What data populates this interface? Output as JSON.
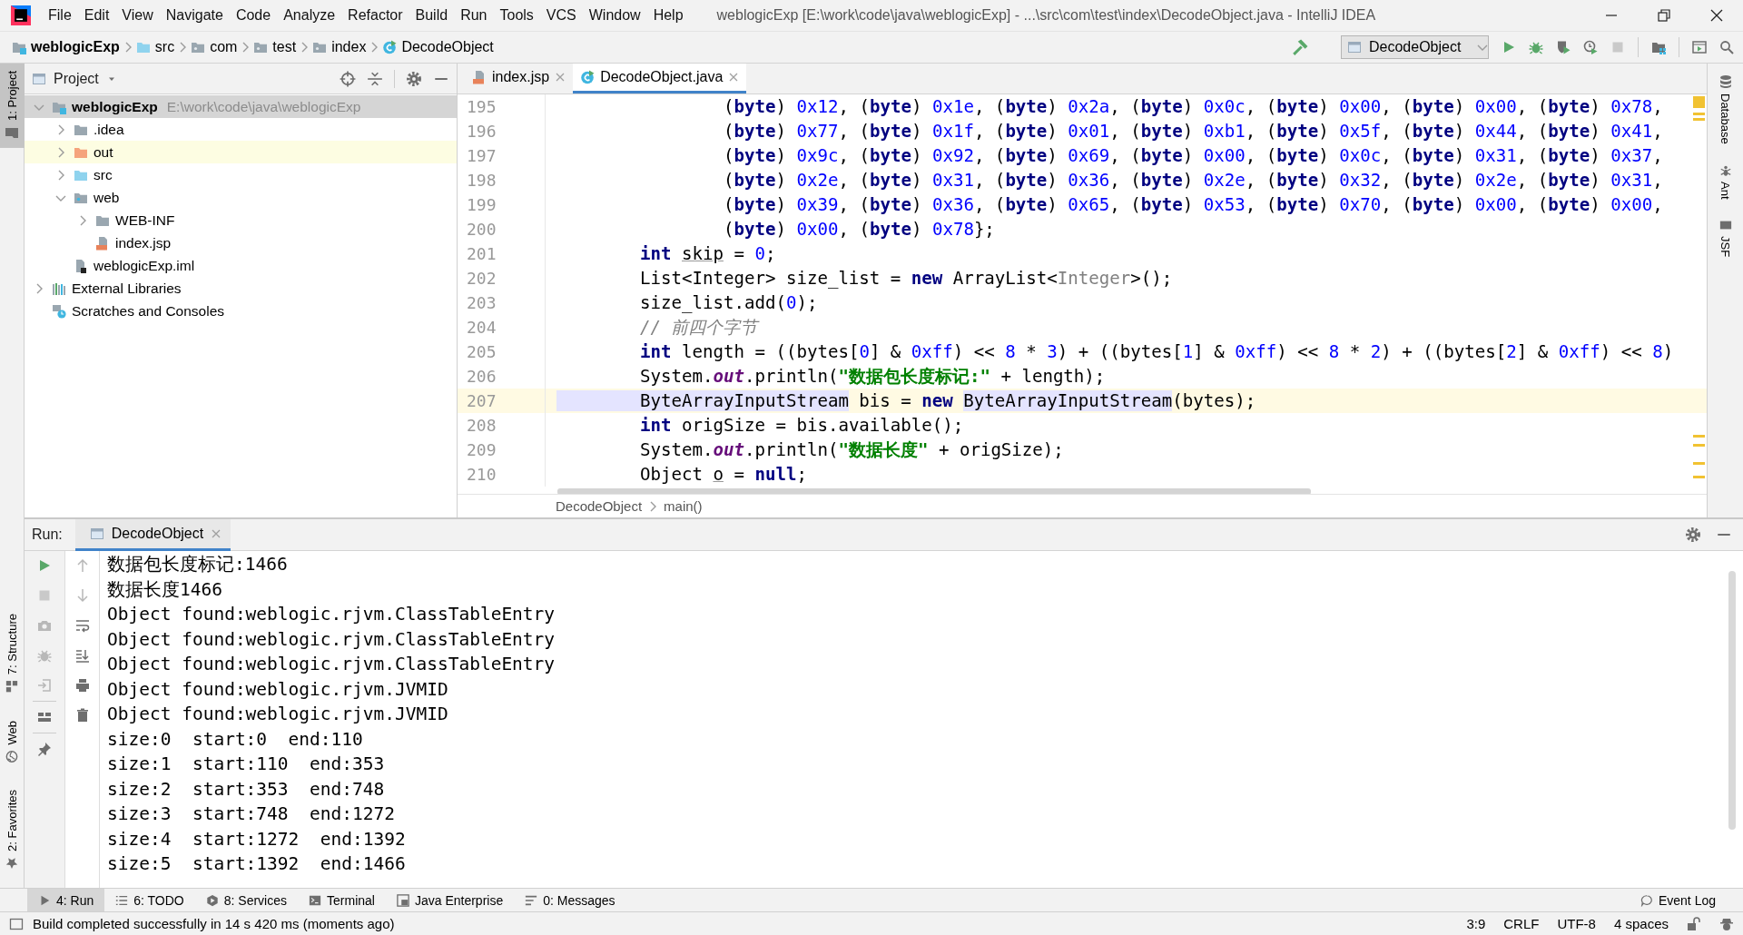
{
  "window": {
    "title": "weblogicExp [E:\\work\\code\\java\\weblogicExp] - ...\\src\\com\\test\\index\\DecodeObject.java - IntelliJ IDEA"
  },
  "menu": [
    "File",
    "Edit",
    "View",
    "Navigate",
    "Code",
    "Analyze",
    "Refactor",
    "Build",
    "Run",
    "Tools",
    "VCS",
    "Window",
    "Help"
  ],
  "breadcrumbs": [
    {
      "label": "weblogicExp",
      "kind": "module"
    },
    {
      "label": "src",
      "kind": "source"
    },
    {
      "label": "com",
      "kind": "package"
    },
    {
      "label": "test",
      "kind": "package"
    },
    {
      "label": "index",
      "kind": "package"
    },
    {
      "label": "DecodeObject",
      "kind": "class"
    }
  ],
  "run_configuration": "DecodeObject",
  "left_strip": [
    {
      "label": "1: Project",
      "kind": "project",
      "selected": true
    },
    {
      "label": "7: Structure",
      "kind": "structure",
      "selected": false
    },
    {
      "label": "Web",
      "kind": "web",
      "selected": false
    },
    {
      "label": "2: Favorites",
      "kind": "favorites",
      "selected": false
    }
  ],
  "project": {
    "title": "Project",
    "tree": [
      {
        "label": "weblogicExp",
        "path": "E:\\work\\code\\java\\weblogicExp",
        "kind": "module",
        "selected": true,
        "highlighted": false,
        "expanded": true,
        "children": [
          {
            "label": ".idea",
            "kind": "folder",
            "selected": false,
            "highlighted": false,
            "expanded": false
          },
          {
            "label": "out",
            "kind": "excluded",
            "selected": false,
            "highlighted": true,
            "expanded": false
          },
          {
            "label": "src",
            "kind": "source",
            "selected": false,
            "highlighted": false,
            "expanded": false
          },
          {
            "label": "web",
            "kind": "web",
            "selected": false,
            "highlighted": false,
            "expanded": true,
            "children": [
              {
                "label": "WEB-INF",
                "kind": "folder",
                "selected": false,
                "highlighted": false,
                "expanded": false
              },
              {
                "label": "index.jsp",
                "kind": "jsp",
                "selected": false,
                "highlighted": false
              }
            ]
          },
          {
            "label": "weblogicExp.iml",
            "kind": "iml",
            "selected": false,
            "highlighted": false
          }
        ]
      },
      {
        "label": "External Libraries",
        "kind": "libraries",
        "selected": false,
        "highlighted": false,
        "expanded": false
      },
      {
        "label": "Scratches and Consoles",
        "kind": "scratches",
        "selected": false,
        "highlighted": false
      }
    ]
  },
  "editor": {
    "tabs": [
      {
        "label": "index.jsp",
        "kind": "jsp",
        "selected": false
      },
      {
        "label": "DecodeObject.java",
        "kind": "class",
        "selected": true
      }
    ],
    "lines": [
      {
        "number": "195",
        "current": false,
        "tokens": [
          {
            "kind": "plain",
            "text": "                ("
          },
          {
            "kind": "keyword",
            "text": "byte"
          },
          {
            "kind": "plain",
            "text": ") "
          },
          {
            "kind": "number",
            "text": "0x12"
          },
          {
            "kind": "plain",
            "text": ", ("
          },
          {
            "kind": "keyword",
            "text": "byte"
          },
          {
            "kind": "plain",
            "text": ") "
          },
          {
            "kind": "number",
            "text": "0x1e"
          },
          {
            "kind": "plain",
            "text": ", ("
          },
          {
            "kind": "keyword",
            "text": "byte"
          },
          {
            "kind": "plain",
            "text": ") "
          },
          {
            "kind": "number",
            "text": "0x2a"
          },
          {
            "kind": "plain",
            "text": ", ("
          },
          {
            "kind": "keyword",
            "text": "byte"
          },
          {
            "kind": "plain",
            "text": ") "
          },
          {
            "kind": "number",
            "text": "0x0c"
          },
          {
            "kind": "plain",
            "text": ", ("
          },
          {
            "kind": "keyword",
            "text": "byte"
          },
          {
            "kind": "plain",
            "text": ") "
          },
          {
            "kind": "number",
            "text": "0x00"
          },
          {
            "kind": "plain",
            "text": ", ("
          },
          {
            "kind": "keyword",
            "text": "byte"
          },
          {
            "kind": "plain",
            "text": ") "
          },
          {
            "kind": "number",
            "text": "0x00"
          },
          {
            "kind": "plain",
            "text": ", ("
          },
          {
            "kind": "keyword",
            "text": "byte"
          },
          {
            "kind": "plain",
            "text": ") "
          },
          {
            "kind": "number",
            "text": "0x78"
          },
          {
            "kind": "plain",
            "text": ","
          }
        ]
      },
      {
        "number": "196",
        "current": false,
        "tokens": [
          {
            "kind": "plain",
            "text": "                ("
          },
          {
            "kind": "keyword",
            "text": "byte"
          },
          {
            "kind": "plain",
            "text": ") "
          },
          {
            "kind": "number",
            "text": "0x77"
          },
          {
            "kind": "plain",
            "text": ", ("
          },
          {
            "kind": "keyword",
            "text": "byte"
          },
          {
            "kind": "plain",
            "text": ") "
          },
          {
            "kind": "number",
            "text": "0x1f"
          },
          {
            "kind": "plain",
            "text": ", ("
          },
          {
            "kind": "keyword",
            "text": "byte"
          },
          {
            "kind": "plain",
            "text": ") "
          },
          {
            "kind": "number",
            "text": "0x01"
          },
          {
            "kind": "plain",
            "text": ", ("
          },
          {
            "kind": "keyword",
            "text": "byte"
          },
          {
            "kind": "plain",
            "text": ") "
          },
          {
            "kind": "number",
            "text": "0xb1"
          },
          {
            "kind": "plain",
            "text": ", ("
          },
          {
            "kind": "keyword",
            "text": "byte"
          },
          {
            "kind": "plain",
            "text": ") "
          },
          {
            "kind": "number",
            "text": "0x5f"
          },
          {
            "kind": "plain",
            "text": ", ("
          },
          {
            "kind": "keyword",
            "text": "byte"
          },
          {
            "kind": "plain",
            "text": ") "
          },
          {
            "kind": "number",
            "text": "0x44"
          },
          {
            "kind": "plain",
            "text": ", ("
          },
          {
            "kind": "keyword",
            "text": "byte"
          },
          {
            "kind": "plain",
            "text": ") "
          },
          {
            "kind": "number",
            "text": "0x41"
          },
          {
            "kind": "plain",
            "text": ","
          }
        ]
      },
      {
        "number": "197",
        "current": false,
        "tokens": [
          {
            "kind": "plain",
            "text": "                ("
          },
          {
            "kind": "keyword",
            "text": "byte"
          },
          {
            "kind": "plain",
            "text": ") "
          },
          {
            "kind": "number",
            "text": "0x9c"
          },
          {
            "kind": "plain",
            "text": ", ("
          },
          {
            "kind": "keyword",
            "text": "byte"
          },
          {
            "kind": "plain",
            "text": ") "
          },
          {
            "kind": "number",
            "text": "0x92"
          },
          {
            "kind": "plain",
            "text": ", ("
          },
          {
            "kind": "keyword",
            "text": "byte"
          },
          {
            "kind": "plain",
            "text": ") "
          },
          {
            "kind": "number",
            "text": "0x69"
          },
          {
            "kind": "plain",
            "text": ", ("
          },
          {
            "kind": "keyword",
            "text": "byte"
          },
          {
            "kind": "plain",
            "text": ") "
          },
          {
            "kind": "number",
            "text": "0x00"
          },
          {
            "kind": "plain",
            "text": ", ("
          },
          {
            "kind": "keyword",
            "text": "byte"
          },
          {
            "kind": "plain",
            "text": ") "
          },
          {
            "kind": "number",
            "text": "0x0c"
          },
          {
            "kind": "plain",
            "text": ", ("
          },
          {
            "kind": "keyword",
            "text": "byte"
          },
          {
            "kind": "plain",
            "text": ") "
          },
          {
            "kind": "number",
            "text": "0x31"
          },
          {
            "kind": "plain",
            "text": ", ("
          },
          {
            "kind": "keyword",
            "text": "byte"
          },
          {
            "kind": "plain",
            "text": ") "
          },
          {
            "kind": "number",
            "text": "0x37"
          },
          {
            "kind": "plain",
            "text": ","
          }
        ]
      },
      {
        "number": "198",
        "current": false,
        "tokens": [
          {
            "kind": "plain",
            "text": "                ("
          },
          {
            "kind": "keyword",
            "text": "byte"
          },
          {
            "kind": "plain",
            "text": ") "
          },
          {
            "kind": "number",
            "text": "0x2e"
          },
          {
            "kind": "plain",
            "text": ", ("
          },
          {
            "kind": "keyword",
            "text": "byte"
          },
          {
            "kind": "plain",
            "text": ") "
          },
          {
            "kind": "number",
            "text": "0x31"
          },
          {
            "kind": "plain",
            "text": ", ("
          },
          {
            "kind": "keyword",
            "text": "byte"
          },
          {
            "kind": "plain",
            "text": ") "
          },
          {
            "kind": "number",
            "text": "0x36"
          },
          {
            "kind": "plain",
            "text": ", ("
          },
          {
            "kind": "keyword",
            "text": "byte"
          },
          {
            "kind": "plain",
            "text": ") "
          },
          {
            "kind": "number",
            "text": "0x2e"
          },
          {
            "kind": "plain",
            "text": ", ("
          },
          {
            "kind": "keyword",
            "text": "byte"
          },
          {
            "kind": "plain",
            "text": ") "
          },
          {
            "kind": "number",
            "text": "0x32"
          },
          {
            "kind": "plain",
            "text": ", ("
          },
          {
            "kind": "keyword",
            "text": "byte"
          },
          {
            "kind": "plain",
            "text": ") "
          },
          {
            "kind": "number",
            "text": "0x2e"
          },
          {
            "kind": "plain",
            "text": ", ("
          },
          {
            "kind": "keyword",
            "text": "byte"
          },
          {
            "kind": "plain",
            "text": ") "
          },
          {
            "kind": "number",
            "text": "0x31"
          },
          {
            "kind": "plain",
            "text": ","
          }
        ]
      },
      {
        "number": "199",
        "current": false,
        "tokens": [
          {
            "kind": "plain",
            "text": "                ("
          },
          {
            "kind": "keyword",
            "text": "byte"
          },
          {
            "kind": "plain",
            "text": ") "
          },
          {
            "kind": "number",
            "text": "0x39"
          },
          {
            "kind": "plain",
            "text": ", ("
          },
          {
            "kind": "keyword",
            "text": "byte"
          },
          {
            "kind": "plain",
            "text": ") "
          },
          {
            "kind": "number",
            "text": "0x36"
          },
          {
            "kind": "plain",
            "text": ", ("
          },
          {
            "kind": "keyword",
            "text": "byte"
          },
          {
            "kind": "plain",
            "text": ") "
          },
          {
            "kind": "number",
            "text": "0x65"
          },
          {
            "kind": "plain",
            "text": ", ("
          },
          {
            "kind": "keyword",
            "text": "byte"
          },
          {
            "kind": "plain",
            "text": ") "
          },
          {
            "kind": "number",
            "text": "0x53"
          },
          {
            "kind": "plain",
            "text": ", ("
          },
          {
            "kind": "keyword",
            "text": "byte"
          },
          {
            "kind": "plain",
            "text": ") "
          },
          {
            "kind": "number",
            "text": "0x70"
          },
          {
            "kind": "plain",
            "text": ", ("
          },
          {
            "kind": "keyword",
            "text": "byte"
          },
          {
            "kind": "plain",
            "text": ") "
          },
          {
            "kind": "number",
            "text": "0x00"
          },
          {
            "kind": "plain",
            "text": ", ("
          },
          {
            "kind": "keyword",
            "text": "byte"
          },
          {
            "kind": "plain",
            "text": ") "
          },
          {
            "kind": "number",
            "text": "0x00"
          },
          {
            "kind": "plain",
            "text": ","
          }
        ]
      },
      {
        "number": "200",
        "current": false,
        "tokens": [
          {
            "kind": "plain",
            "text": "                ("
          },
          {
            "kind": "keyword",
            "text": "byte"
          },
          {
            "kind": "plain",
            "text": ") "
          },
          {
            "kind": "number",
            "text": "0x00"
          },
          {
            "kind": "plain",
            "text": ", ("
          },
          {
            "kind": "keyword",
            "text": "byte"
          },
          {
            "kind": "plain",
            "text": ") "
          },
          {
            "kind": "number",
            "text": "0x78"
          },
          {
            "kind": "plain",
            "text": "};"
          }
        ]
      },
      {
        "number": "201",
        "current": false,
        "tokens": [
          {
            "kind": "keyword",
            "text": "        int "
          },
          {
            "kind": "unused",
            "text": "skip"
          },
          {
            "kind": "plain",
            "text": " = "
          },
          {
            "kind": "number",
            "text": "0"
          },
          {
            "kind": "plain",
            "text": ";"
          }
        ]
      },
      {
        "number": "202",
        "current": false,
        "tokens": [
          {
            "kind": "plain",
            "text": "        List<Integer> size_list = "
          },
          {
            "kind": "keyword",
            "text": "new"
          },
          {
            "kind": "plain",
            "text": " ArrayList<"
          },
          {
            "kind": "inferred",
            "text": "Integer"
          },
          {
            "kind": "plain",
            "text": ">();"
          }
        ]
      },
      {
        "number": "203",
        "current": false,
        "tokens": [
          {
            "kind": "plain",
            "text": "        size_list.add("
          },
          {
            "kind": "number",
            "text": "0"
          },
          {
            "kind": "plain",
            "text": ");"
          }
        ]
      },
      {
        "number": "204",
        "current": false,
        "tokens": [
          {
            "kind": "comment",
            "text": "        // 前四个字节"
          }
        ]
      },
      {
        "number": "205",
        "current": false,
        "tokens": [
          {
            "kind": "keyword",
            "text": "        int"
          },
          {
            "kind": "plain",
            "text": " length = ((bytes["
          },
          {
            "kind": "number",
            "text": "0"
          },
          {
            "kind": "plain",
            "text": "] & "
          },
          {
            "kind": "number",
            "text": "0xff"
          },
          {
            "kind": "plain",
            "text": ") << "
          },
          {
            "kind": "number",
            "text": "8"
          },
          {
            "kind": "plain",
            "text": " * "
          },
          {
            "kind": "number",
            "text": "3"
          },
          {
            "kind": "plain",
            "text": ") + ((bytes["
          },
          {
            "kind": "number",
            "text": "1"
          },
          {
            "kind": "plain",
            "text": "] & "
          },
          {
            "kind": "number",
            "text": "0xff"
          },
          {
            "kind": "plain",
            "text": ") << "
          },
          {
            "kind": "number",
            "text": "8"
          },
          {
            "kind": "plain",
            "text": " * "
          },
          {
            "kind": "number",
            "text": "2"
          },
          {
            "kind": "plain",
            "text": ") + ((bytes["
          },
          {
            "kind": "number",
            "text": "2"
          },
          {
            "kind": "plain",
            "text": "] & "
          },
          {
            "kind": "number",
            "text": "0xff"
          },
          {
            "kind": "plain",
            "text": ") << "
          },
          {
            "kind": "number",
            "text": "8"
          },
          {
            "kind": "plain",
            "text": ")"
          }
        ]
      },
      {
        "number": "206",
        "current": false,
        "tokens": [
          {
            "kind": "plain",
            "text": "        System."
          },
          {
            "kind": "static",
            "text": "out"
          },
          {
            "kind": "plain",
            "text": ".println("
          },
          {
            "kind": "string",
            "text": "\"数据包长度标记:\""
          },
          {
            "kind": "plain",
            "text": " + length);"
          }
        ]
      },
      {
        "number": "207",
        "current": true,
        "tokens": [
          {
            "kind": "usage",
            "text": "        ByteArrayInputStream"
          },
          {
            "kind": "plain",
            "text": " bis = "
          },
          {
            "kind": "keyword",
            "text": "new "
          },
          {
            "kind": "usage",
            "text": "ByteArrayInputStream"
          },
          {
            "kind": "plain",
            "text": "(bytes);"
          }
        ]
      },
      {
        "number": "208",
        "current": false,
        "tokens": [
          {
            "kind": "keyword",
            "text": "        int"
          },
          {
            "kind": "plain",
            "text": " origSize = bis.available();"
          }
        ]
      },
      {
        "number": "209",
        "current": false,
        "tokens": [
          {
            "kind": "plain",
            "text": "        System."
          },
          {
            "kind": "static",
            "text": "out"
          },
          {
            "kind": "plain",
            "text": ".println("
          },
          {
            "kind": "string",
            "text": "\"数据长度\""
          },
          {
            "kind": "plain",
            "text": " + origSize);"
          }
        ]
      },
      {
        "number": "210",
        "current": false,
        "tokens": [
          {
            "kind": "plain",
            "text": "        Object "
          },
          {
            "kind": "unused",
            "text": "o"
          },
          {
            "kind": "plain",
            "text": " = "
          },
          {
            "kind": "keyword",
            "text": "null"
          },
          {
            "kind": "plain",
            "text": ";"
          }
        ]
      }
    ],
    "breadcrumb": [
      "DecodeObject",
      "main()"
    ]
  },
  "right_strip": [
    {
      "label": "Database",
      "kind": "database"
    },
    {
      "label": "Ant",
      "kind": "ant"
    },
    {
      "label": "JSF",
      "kind": "jsf"
    }
  ],
  "run": {
    "label": "Run:",
    "tabs": [
      {
        "label": "DecodeObject",
        "selected": true
      }
    ],
    "console": [
      "数据包长度标记:1466",
      "数据长度1466",
      "Object found:weblogic.rjvm.ClassTableEntry",
      "Object found:weblogic.rjvm.ClassTableEntry",
      "Object found:weblogic.rjvm.ClassTableEntry",
      "Object found:weblogic.rjvm.JVMID",
      "Object found:weblogic.rjvm.JVMID",
      "size:0  start:0  end:110",
      "size:1  start:110  end:353",
      "size:2  start:353  end:748",
      "size:3  start:748  end:1272",
      "size:4  start:1272  end:1392",
      "size:5  start:1392  end:1466"
    ]
  },
  "tool_tabs": [
    {
      "label": "4: Run",
      "kind": "run",
      "selected": true
    },
    {
      "label": "6: TODO",
      "kind": "todo",
      "selected": false
    },
    {
      "label": "8: Services",
      "kind": "services",
      "selected": false
    },
    {
      "label": "Terminal",
      "kind": "terminal",
      "selected": false
    },
    {
      "label": "Java Enterprise",
      "kind": "enterprise",
      "selected": false
    },
    {
      "label": "0: Messages",
      "kind": "messages",
      "selected": false
    }
  ],
  "event_log": "Event Log",
  "status_bar": {
    "message": "Build completed successfully in 14 s 420 ms (moments ago)",
    "widgets": [
      "3:9",
      "CRLF",
      "UTF-8",
      "4 spaces"
    ]
  }
}
